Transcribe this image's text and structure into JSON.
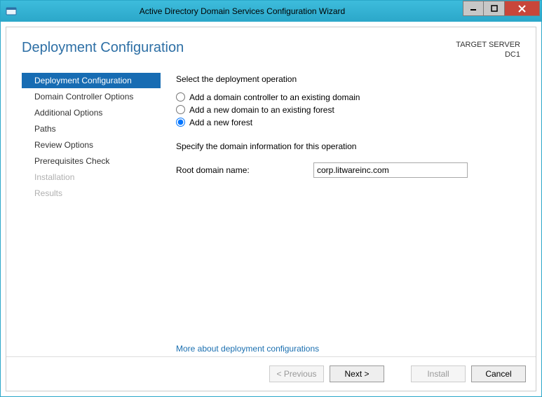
{
  "window": {
    "title": "Active Directory Domain Services Configuration Wizard"
  },
  "header": {
    "page_title": "Deployment Configuration",
    "target_label": "TARGET SERVER",
    "target_value": "DC1"
  },
  "sidebar": {
    "items": [
      {
        "label": "Deployment Configuration",
        "state": "active"
      },
      {
        "label": "Domain Controller Options",
        "state": "normal"
      },
      {
        "label": "Additional Options",
        "state": "normal"
      },
      {
        "label": "Paths",
        "state": "normal"
      },
      {
        "label": "Review Options",
        "state": "normal"
      },
      {
        "label": "Prerequisites Check",
        "state": "normal"
      },
      {
        "label": "Installation",
        "state": "disabled"
      },
      {
        "label": "Results",
        "state": "disabled"
      }
    ]
  },
  "content": {
    "select_label": "Select the deployment operation",
    "radios": {
      "option1": "Add a domain controller to an existing domain",
      "option2": "Add a new domain to an existing forest",
      "option3": "Add a new forest",
      "selected": "option3"
    },
    "specify_label": "Specify the domain information for this operation",
    "root_domain_label": "Root domain name:",
    "root_domain_value": "corp.litwareinc.com",
    "help_link": "More about deployment configurations"
  },
  "footer": {
    "previous": "< Previous",
    "next": "Next >",
    "install": "Install",
    "cancel": "Cancel"
  }
}
